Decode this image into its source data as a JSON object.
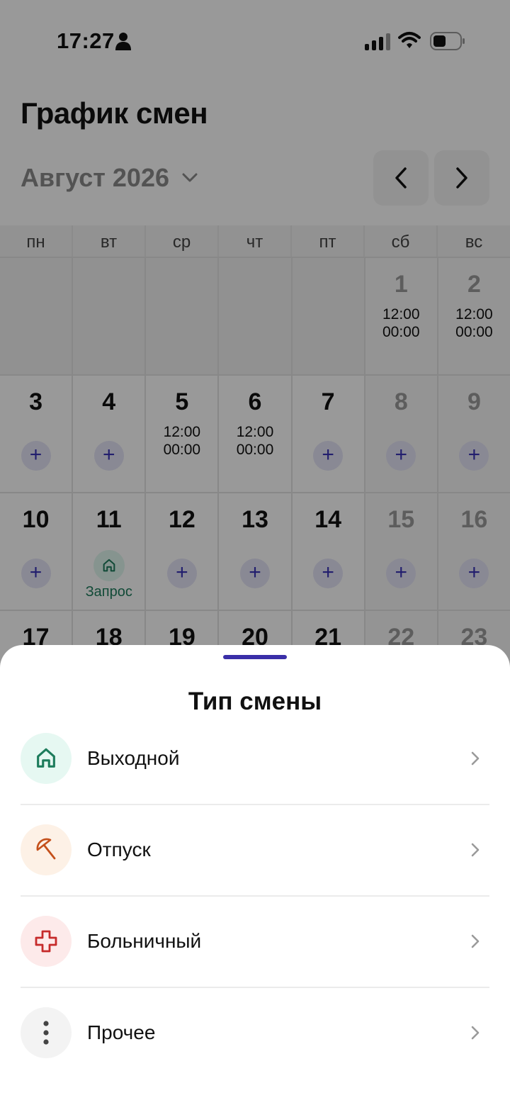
{
  "status_bar": {
    "time": "17:27",
    "icons": [
      "person-icon",
      "cellular-signal-icon",
      "wifi-icon",
      "battery-icon"
    ]
  },
  "header": {
    "title": "График смен",
    "month": "Август 2026"
  },
  "calendar": {
    "weekdays": [
      "пн",
      "вт",
      "ср",
      "чт",
      "пт",
      "сб",
      "вс"
    ],
    "days": {
      "d1": {
        "num": "1",
        "start": "12:00",
        "end": "00:00"
      },
      "d2": {
        "num": "2",
        "start": "12:00",
        "end": "00:00"
      },
      "d3": {
        "num": "3"
      },
      "d4": {
        "num": "4"
      },
      "d5": {
        "num": "5",
        "start": "12:00",
        "end": "00:00"
      },
      "d6": {
        "num": "6",
        "start": "12:00",
        "end": "00:00"
      },
      "d7": {
        "num": "7"
      },
      "d8": {
        "num": "8"
      },
      "d9": {
        "num": "9"
      },
      "d10": {
        "num": "10"
      },
      "d11": {
        "num": "11",
        "request": "Запрос"
      },
      "d12": {
        "num": "12"
      },
      "d13": {
        "num": "13"
      },
      "d14": {
        "num": "14"
      },
      "d15": {
        "num": "15"
      },
      "d16": {
        "num": "16"
      },
      "d17": {
        "num": "17"
      },
      "d18": {
        "num": "18"
      },
      "d19": {
        "num": "19"
      },
      "d20": {
        "num": "20"
      },
      "d21": {
        "num": "21"
      },
      "d22": {
        "num": "22"
      },
      "d23": {
        "num": "23"
      }
    },
    "add_symbol": "+"
  },
  "sheet": {
    "title": "Тип смены",
    "options": [
      {
        "label": "Выходной",
        "icon": "house-icon",
        "color": "#1d7c5c",
        "bg": "#e6f8f2"
      },
      {
        "label": "Отпуск",
        "icon": "umbrella-icon",
        "color": "#c4501b",
        "bg": "#fdf1e6"
      },
      {
        "label": "Больничный",
        "icon": "medical-cross-icon",
        "color": "#c62b2b",
        "bg": "#fdeaea"
      },
      {
        "label": "Прочее",
        "icon": "more-vertical-icon",
        "color": "#444444",
        "bg": "#f3f3f3"
      }
    ]
  },
  "colors": {
    "accent": "#3a2fa8",
    "add_button_bg": "#e5e4f7"
  }
}
